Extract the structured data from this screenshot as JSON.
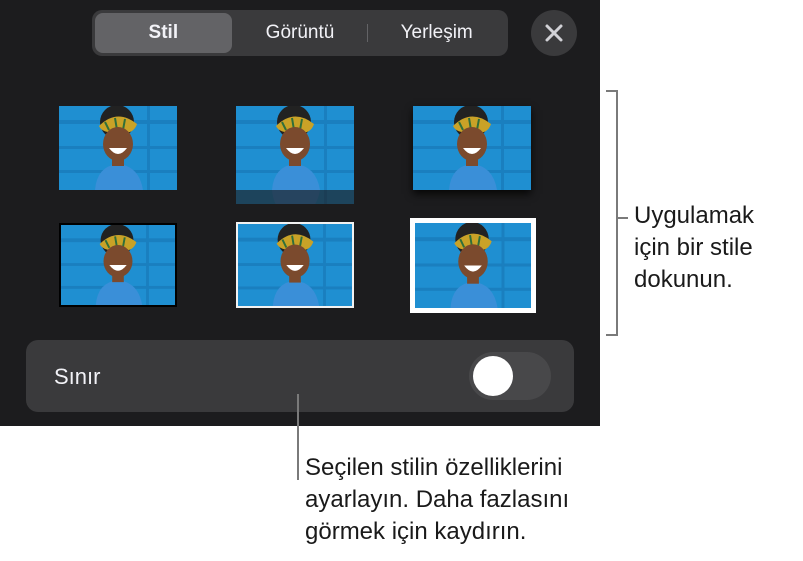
{
  "tabs": [
    {
      "label": "Stil",
      "active": true
    },
    {
      "label": "Görüntü",
      "active": false
    },
    {
      "label": "Yerleşim",
      "active": false
    }
  ],
  "close_icon": "close-icon",
  "styles": [
    {
      "style": "plain"
    },
    {
      "style": "reflection"
    },
    {
      "style": "shadow"
    },
    {
      "style": "thin-border"
    },
    {
      "style": "white-frame"
    },
    {
      "style": "thick-white-frame"
    }
  ],
  "border": {
    "label": "Sınır",
    "enabled": false
  },
  "callouts": {
    "styles_line1": "Uygulamak",
    "styles_line2": "için bir stile",
    "styles_line3": "dokunun.",
    "options_line1": "Seçilen stilin özelliklerini",
    "options_line2": "ayarlayın. Daha fazlasını",
    "options_line3": "görmek için kaydırın."
  },
  "colors": {
    "panel": "#1c1c1e",
    "control": "#3a3a3c",
    "photo_background": "#1f8fd1",
    "shirt": "#3a8fd8"
  }
}
